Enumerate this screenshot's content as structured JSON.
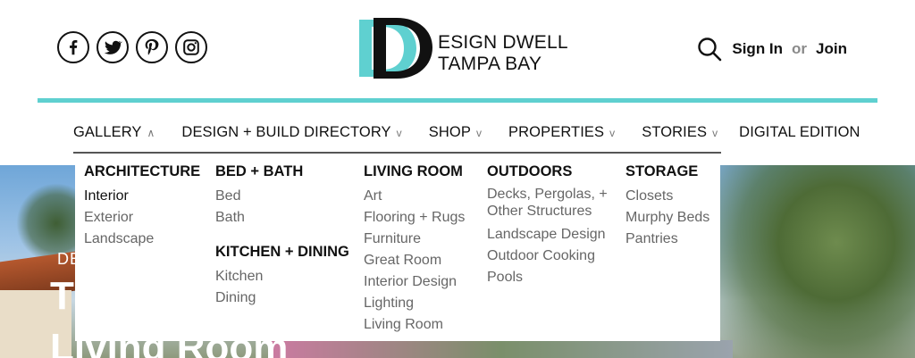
{
  "social": {
    "icons": [
      "facebook-icon",
      "twitter-icon",
      "pinterest-icon",
      "instagram-icon"
    ]
  },
  "brand": {
    "line1": "ESIGN DWELL",
    "line2": "TAMPA BAY",
    "accent_color": "#5fd0d0"
  },
  "auth": {
    "sign_in": "Sign In",
    "or": "or",
    "join": "Join"
  },
  "nav": {
    "items": [
      {
        "label": "GALLERY",
        "chevron": "∧"
      },
      {
        "label": "DESIGN + BUILD DIRECTORY",
        "chevron": "v"
      },
      {
        "label": "SHOP",
        "chevron": "v"
      },
      {
        "label": "PROPERTIES",
        "chevron": "v"
      },
      {
        "label": "STORIES",
        "chevron": "v"
      },
      {
        "label": "DIGITAL EDITION",
        "chevron": ""
      }
    ]
  },
  "menu": {
    "architecture": {
      "title": "ARCHITECTURE",
      "items": [
        "Interior",
        "Exterior",
        "Landscape"
      ]
    },
    "bed_bath": {
      "title": "BED + BATH",
      "items": [
        "Bed",
        "Bath"
      ]
    },
    "kitchen_dining": {
      "title": "KITCHEN + DINING",
      "items": [
        "Kitchen",
        "Dining"
      ]
    },
    "living_room": {
      "title": "LIVING ROOM",
      "items": [
        "Art",
        "Flooring + Rugs",
        "Furniture",
        "Great Room",
        "Interior Design",
        "Lighting",
        "Living Room"
      ]
    },
    "outdoors": {
      "title": "OUTDOORS",
      "items": [
        "Decks, Pergolas, + Other Structures",
        "Landscape Design",
        "Outdoor Cooking",
        "Pools"
      ]
    },
    "storage": {
      "title": "STORAGE",
      "items": [
        "Closets",
        "Murphy Beds",
        "Pantries"
      ]
    }
  },
  "hero": {
    "kicker": "DE",
    "title_line1": "T",
    "title_line2": "Living Room"
  }
}
